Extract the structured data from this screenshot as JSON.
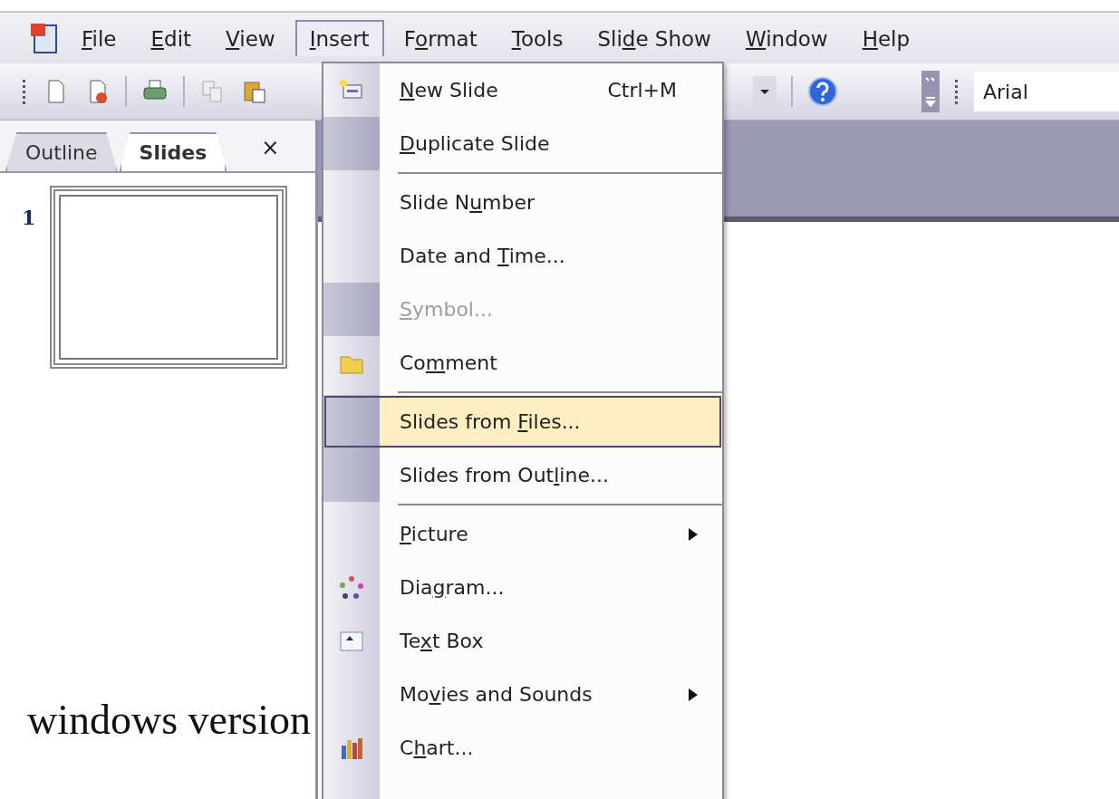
{
  "menu_bar": [
    {
      "key": "F",
      "post": "ile",
      "selected": false
    },
    {
      "key": "E",
      "post": "dit",
      "selected": false
    },
    {
      "key": "V",
      "post": "iew",
      "selected": false
    },
    {
      "key": "I",
      "post": "nsert",
      "selected": true
    },
    {
      "pre": "F",
      "key": "o",
      "post": "rmat",
      "selected": false
    },
    {
      "key": "T",
      "post": "ools",
      "selected": false
    },
    {
      "pre": "Sli",
      "key": "d",
      "post": "e Show",
      "selected": false
    },
    {
      "key": "W",
      "post": "indow",
      "selected": false
    },
    {
      "key": "H",
      "post": "elp",
      "selected": false
    }
  ],
  "toolbar": {
    "font_box": "Arial"
  },
  "pane": {
    "tabs": [
      {
        "label": "Outline",
        "selected": false
      },
      {
        "label": "Slides",
        "selected": true
      }
    ],
    "close": "×",
    "slides": [
      {
        "number": "1"
      }
    ]
  },
  "insert_menu": {
    "items": [
      {
        "kind": "item",
        "key": "N",
        "post": "ew Slide",
        "shortcut": "Ctrl+M",
        "icon": true,
        "rare": false,
        "disabled": false,
        "selected": false
      },
      {
        "kind": "item",
        "key": "D",
        "post": "uplicate Slide",
        "rare": true,
        "disabled": false,
        "selected": false
      },
      {
        "kind": "separator"
      },
      {
        "kind": "item",
        "pre": "Slide N",
        "key": "u",
        "post": "mber",
        "rare": false,
        "disabled": false,
        "selected": false
      },
      {
        "kind": "item",
        "pre": "Date and ",
        "key": "T",
        "post": "ime...",
        "rare": false,
        "disabled": false,
        "selected": false
      },
      {
        "kind": "item",
        "key": "S",
        "post": "ymbol...",
        "rare": true,
        "disabled": true,
        "selected": false
      },
      {
        "kind": "item",
        "pre": "Co",
        "key": "m",
        "post": "ment",
        "icon": true,
        "rare": false,
        "disabled": false,
        "selected": false
      },
      {
        "kind": "separator"
      },
      {
        "kind": "item",
        "pre": "Slides from ",
        "key": "F",
        "post": "iles...",
        "rare": true,
        "disabled": false,
        "selected": true
      },
      {
        "kind": "item",
        "pre": "Slides from Out",
        "key": "l",
        "post": "ine...",
        "rare": true,
        "disabled": false,
        "selected": false
      },
      {
        "kind": "separator"
      },
      {
        "kind": "item",
        "key": "P",
        "post": "icture",
        "rare": false,
        "disabled": false,
        "selected": false,
        "submenu": true
      },
      {
        "kind": "item",
        "pre": "Dia",
        "key": "g",
        "post": "ram...",
        "icon": true,
        "rare": false,
        "disabled": false,
        "selected": false
      },
      {
        "kind": "item",
        "pre": "Te",
        "key": "x",
        "post": "t Box",
        "icon": true,
        "rare": false,
        "disabled": false,
        "selected": false
      },
      {
        "kind": "item",
        "pre": "Mo",
        "key": "v",
        "post": "ies and Sounds",
        "rare": false,
        "disabled": false,
        "selected": false,
        "submenu": true
      },
      {
        "kind": "item",
        "pre": "C",
        "key": "h",
        "post": "art...",
        "icon": true,
        "rare": false,
        "disabled": false,
        "selected": false
      }
    ]
  },
  "caption": "windows version"
}
